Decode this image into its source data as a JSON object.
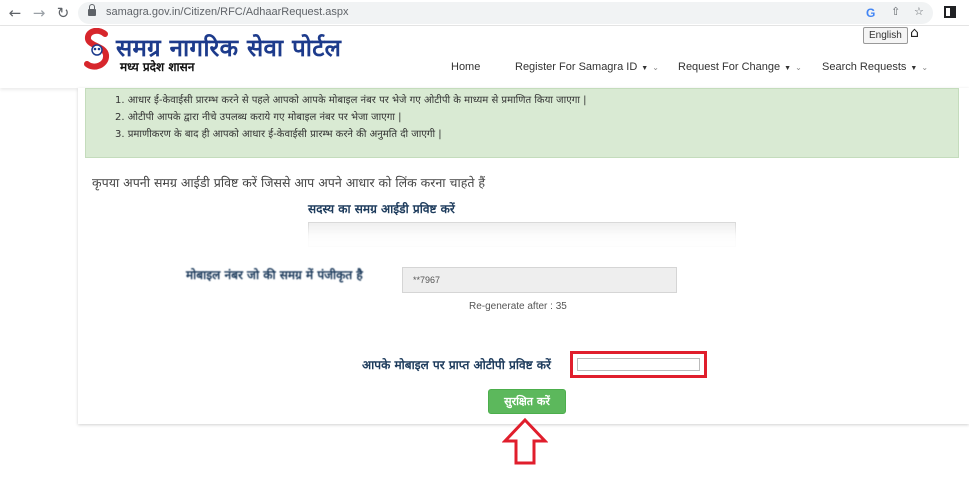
{
  "browser": {
    "url": "samagra.gov.in/Citizen/RFC/AdhaarRequest.aspx",
    "back_icon": "←",
    "forward_icon": "→",
    "reload_icon": "↻",
    "g_icon": "G",
    "share_icon": "⇧",
    "star_icon": "☆"
  },
  "header": {
    "logo_title": "समग्र नागरिक सेवा पोर्टल",
    "logo_subtitle": "मध्य प्रदेश शासन",
    "language_button": "English",
    "home_icon": "⌂",
    "nav": {
      "home": "Home",
      "register": "Register For Samagra ID",
      "request_change": "Request For Change",
      "search": "Search Requests"
    }
  },
  "info": {
    "lines": [
      "1. आधार ई-केवाईसी प्रारम्भ करने से पहले आपको आपके मोबाइल नंबर पर भेजे गए ओटीपी के माध्यम से प्रमाणित किया जाएगा |",
      "2. ओटीपी आपके द्वारा नीचे उपलब्ध कराये गए मोबाइल नंबर पर भेजा जाएगा |",
      "3. प्रमाणीकरण के बाद ही आपको आधार ई-केवाईसी प्रारम्भ करने की अनुमति दी जाएगी |"
    ]
  },
  "form": {
    "prompt": "कृपया अपनी समग्र आईडी प्रविष्ट करें जिससे आप अपने आधार को लिंक करना चाहते हैं",
    "samagra_label": "सदस्य का समग्र आईडी प्रविष्ट करें",
    "mobile_label": "मोबाइल नंबर जो की समग्र में पंजीकृत है",
    "mobile_value": "**7967",
    "regenerate": "Re-generate after : 35",
    "otp_label": "आपके मोबाइल पर प्राप्त ओटीपी प्रविष्ट करें",
    "otp_value": "",
    "save_button": "सुरक्षित करें"
  },
  "colors": {
    "brand": "#1d3b8c",
    "info_bg": "#d9ead3",
    "save_green": "#5cb85c",
    "highlight_red": "#e01e2c"
  }
}
